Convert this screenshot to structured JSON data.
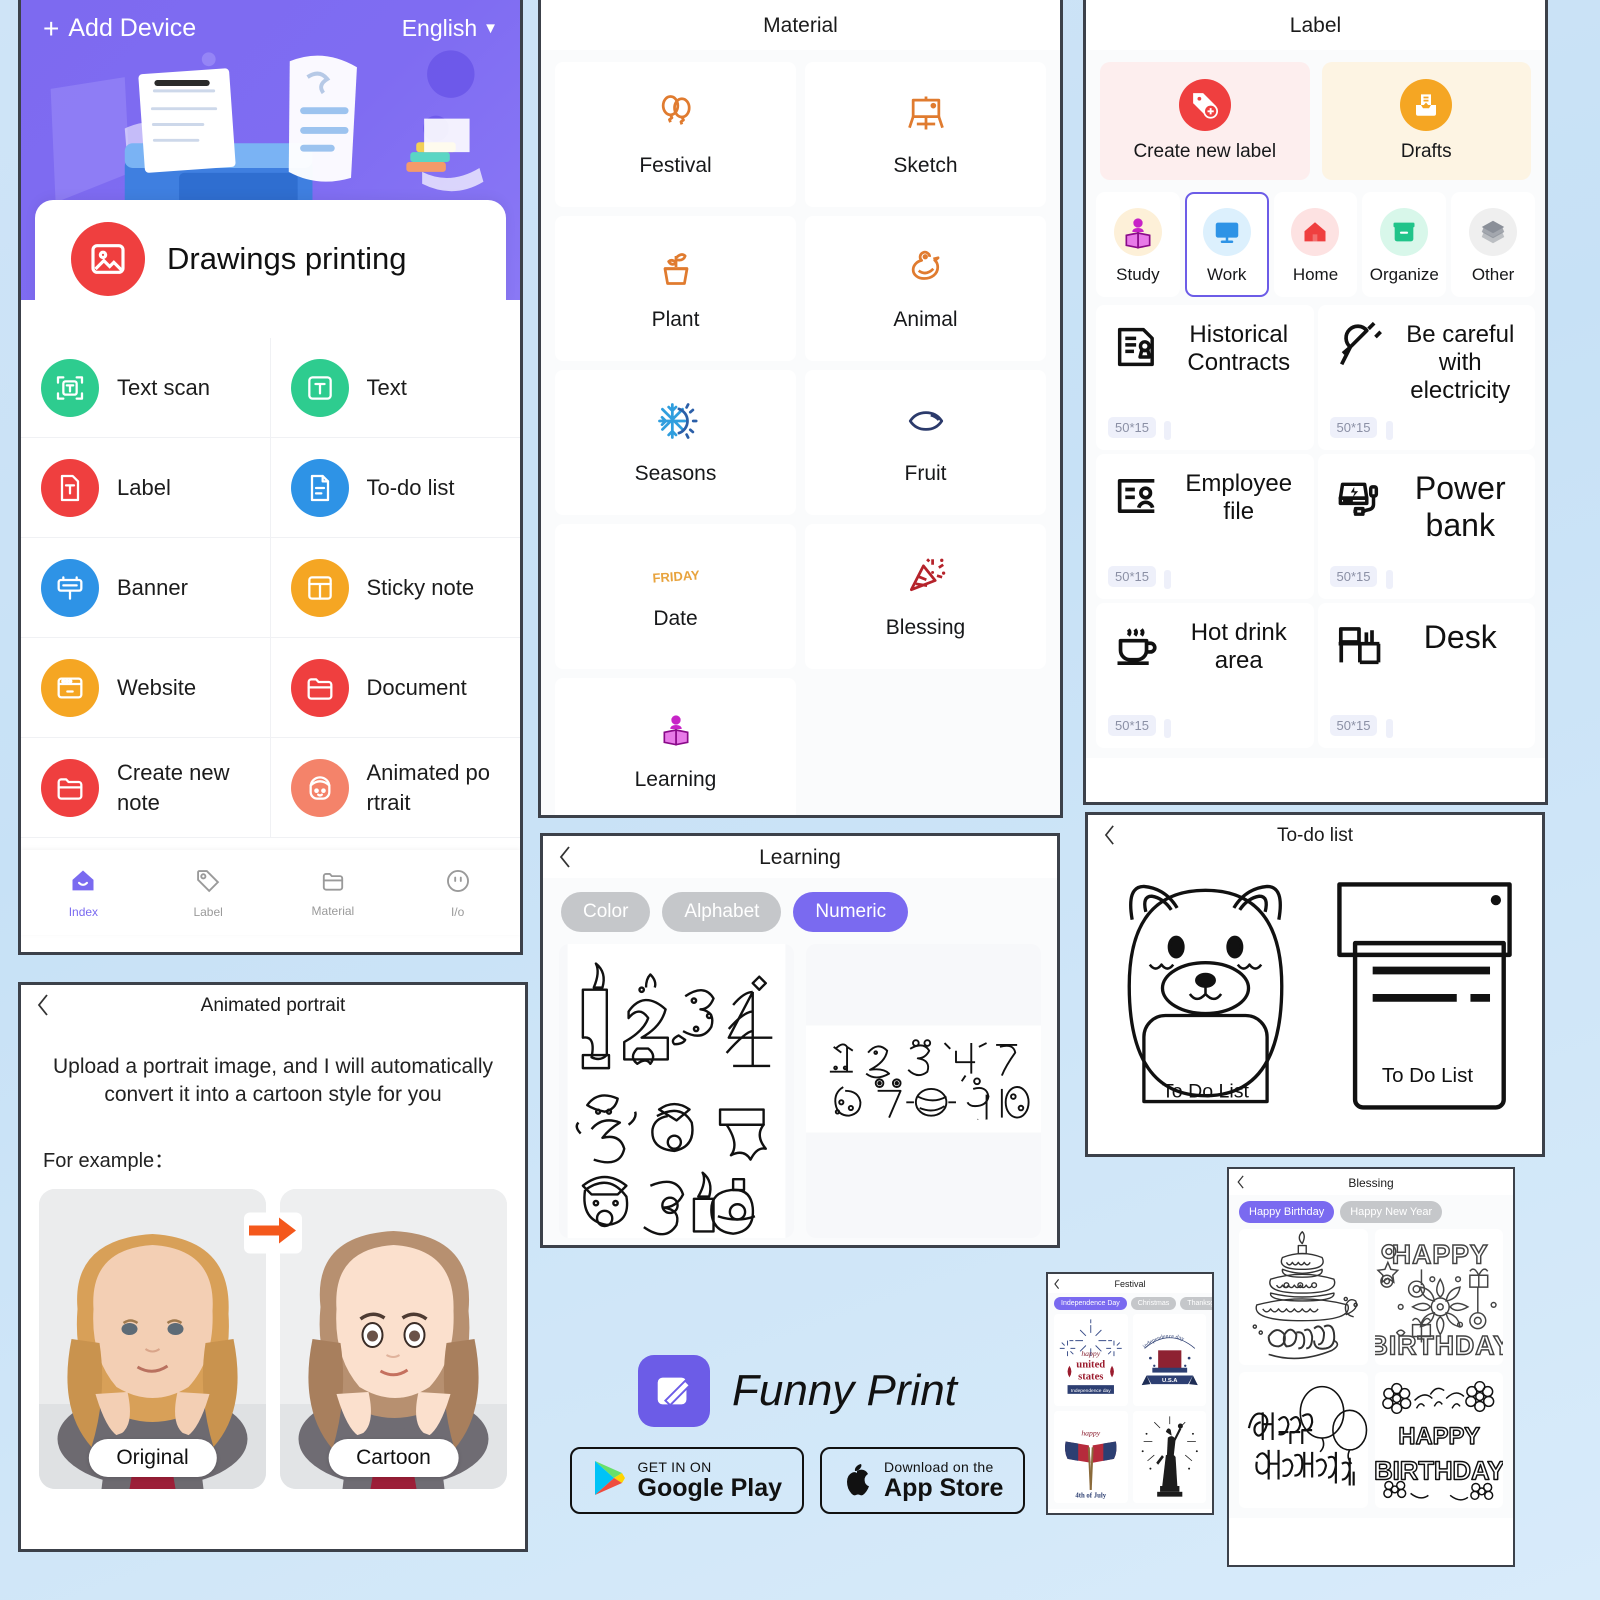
{
  "colors": {
    "brand_purple": "#6c5ce7",
    "accent_purple": "#7a6af0",
    "green": "#2ecc8f",
    "red": "#ef3f3f",
    "blue": "#2e93e6",
    "orange": "#f5a623",
    "salmon": "#f4836a",
    "page_bg": "#cfe4f7"
  },
  "home": {
    "add_device": "Add Device",
    "language": "English",
    "hero_card_title": "Drawings printing",
    "menu": [
      {
        "label": "Text scan",
        "icon": "text-scan-icon",
        "color": "#2ecc8f"
      },
      {
        "label": "Text",
        "icon": "text-icon",
        "color": "#2ecc8f"
      },
      {
        "label": "Label",
        "icon": "label-icon",
        "color": "#ef3f3f"
      },
      {
        "label": "To-do list",
        "icon": "todo-list-icon",
        "color": "#2e93e6"
      },
      {
        "label": "Banner",
        "icon": "banner-icon",
        "color": "#2e93e6"
      },
      {
        "label": "Sticky note",
        "icon": "sticky-note-icon",
        "color": "#f5a623"
      },
      {
        "label": "Website",
        "icon": "website-icon",
        "color": "#f5a623"
      },
      {
        "label": "Document",
        "icon": "document-icon",
        "color": "#ef3f3f"
      },
      {
        "label": "Create new note",
        "icon": "folder-plus-icon",
        "color": "#ef3f3f"
      },
      {
        "label": "Animated po rtrait",
        "icon": "face-icon",
        "color": "#f4836a"
      }
    ],
    "tabs": [
      {
        "label": "Index",
        "icon": "home-icon",
        "active": true
      },
      {
        "label": "Label",
        "icon": "tag-icon",
        "active": false
      },
      {
        "label": "Material",
        "icon": "document-icon",
        "active": false
      },
      {
        "label": "I/o",
        "icon": "smiley-icon",
        "active": false
      }
    ]
  },
  "portrait": {
    "title": "Animated portrait",
    "description": "Upload a portrait image, and I will automatically convert it into a cartoon style for you",
    "example_label": "For example：",
    "before_caption": "Original",
    "after_caption": "Cartoon"
  },
  "material": {
    "title": "Material",
    "items": [
      {
        "label": "Festival",
        "icon": "balloons-icon"
      },
      {
        "label": "Sketch",
        "icon": "easel-icon"
      },
      {
        "label": "Plant",
        "icon": "potted-plant-icon"
      },
      {
        "label": "Animal",
        "icon": "duck-icon"
      },
      {
        "label": "Seasons",
        "icon": "sun-snowflake-icon"
      },
      {
        "label": "Fruit",
        "icon": "lemon-icon"
      },
      {
        "label": "Date",
        "icon": "friday-text-icon"
      },
      {
        "label": "Blessing",
        "icon": "party-popper-icon"
      },
      {
        "label": "Learning",
        "icon": "open-book-icon"
      }
    ]
  },
  "learning": {
    "title": "Learning",
    "chips": [
      {
        "label": "Color",
        "active": false
      },
      {
        "label": "Alphabet",
        "active": false
      },
      {
        "label": "Numeric",
        "active": true
      }
    ],
    "cards": [
      {
        "name": "numbers-christmas-sheet",
        "digits": "1 2 3 4 5 6 7 8 9 10"
      },
      {
        "name": "numbers-doodle-sheet",
        "digits": "1 2 3 4 5 6 7 8 9 10"
      }
    ]
  },
  "label": {
    "title": "Label",
    "actions": [
      {
        "label": "Create new label",
        "icon": "tag-plus-icon",
        "bg": "#fdeeee",
        "color": "#ef3f3f"
      },
      {
        "label": "Drafts",
        "icon": "drafts-inbox-icon",
        "bg": "#fdf4e3",
        "color": "#f5a623"
      }
    ],
    "categories": [
      {
        "label": "Study",
        "icon": "open-book-icon",
        "bg": "#fdf0d8",
        "color": "#f5a623",
        "selected": false
      },
      {
        "label": "Work",
        "icon": "monitor-icon",
        "bg": "#dcf0fd",
        "color": "#2e93e6",
        "selected": true
      },
      {
        "label": "Home",
        "icon": "house-icon",
        "bg": "#fde2e2",
        "color": "#ef3f3f",
        "selected": false
      },
      {
        "label": "Organize",
        "icon": "box-icon",
        "bg": "#d8f7ea",
        "color": "#21c48a",
        "selected": false
      },
      {
        "label": "Other",
        "icon": "layers-icon",
        "bg": "#efefef",
        "color": "#8a8f98",
        "selected": false
      }
    ],
    "cards": [
      {
        "text": "Historical Contracts",
        "size": "50*15",
        "icon": "contract-stamp-icon",
        "big": false
      },
      {
        "text": "Be careful with electricity",
        "size": "50*15",
        "icon": "plug-icon",
        "big": false
      },
      {
        "text": "Employee file",
        "size": "50*15",
        "icon": "id-badge-icon",
        "big": false
      },
      {
        "text": "Power bank",
        "size": "50*15",
        "icon": "power-bank-icon",
        "big": true
      },
      {
        "text": "Hot drink area",
        "size": "50*15",
        "icon": "hot-cup-icon",
        "big": false
      },
      {
        "text": "Desk",
        "size": "50*15",
        "icon": "desk-icon",
        "big": true
      }
    ]
  },
  "todo": {
    "title": "To-do list",
    "cards": [
      {
        "caption": "To Do List",
        "art": "cat-head-outline"
      },
      {
        "caption": "To Do List",
        "art": "printer-outline"
      }
    ]
  },
  "blessing": {
    "title": "Blessing",
    "chips": [
      {
        "label": "Happy Birthday",
        "active": true
      },
      {
        "label": "Happy New Year",
        "active": false
      }
    ],
    "cards": [
      {
        "art": "birthday-cake-lettering",
        "text": "Happy Birthday"
      },
      {
        "art": "happy-birthday-bold",
        "text": "HAPPY BIRTHDAY"
      },
      {
        "art": "happy-birthday-balloons",
        "text": "Happy Birthday!"
      },
      {
        "art": "happy-birthday-flowers",
        "text": "HAPPY BIRTHDAY"
      }
    ]
  },
  "festival": {
    "title": "Festival",
    "chips": [
      {
        "label": "Independence Day",
        "active": true
      },
      {
        "label": "Christmas",
        "active": false
      },
      {
        "label": "Thanksgiving",
        "active": false
      }
    ],
    "cards": [
      {
        "art": "united-states-fireworks",
        "text": "happy united states Independence day"
      },
      {
        "art": "usa-hat-banner",
        "text": "independence day U.S.A"
      },
      {
        "art": "flags-4th-of-july",
        "text": "happy 4th of July"
      },
      {
        "art": "statue-of-liberty",
        "text": ""
      }
    ]
  },
  "brand": {
    "app_name": "Funny Print",
    "stores": [
      {
        "line1": "GET IN ON",
        "line2": "Google Play",
        "icon": "google-play-icon"
      },
      {
        "line1": "Download on the",
        "line2": "App Store",
        "icon": "apple-icon"
      }
    ]
  }
}
